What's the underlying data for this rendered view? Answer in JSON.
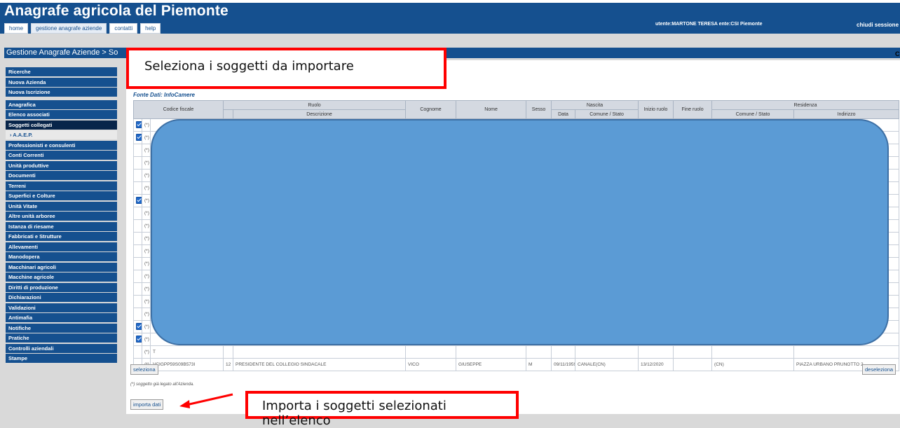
{
  "header": {
    "app_title": "Anagrafe agricola del Piemonte",
    "nav": [
      "home",
      "gestione anagrafe aziende",
      "contatti",
      "help"
    ],
    "user_info": "utente:MARTONE TERESA  ente:CSI Piemonte",
    "logout": "chiudi sessione"
  },
  "breadcrumb": "Gestione Anagrafe Aziende > So",
  "breadcrumb_edge": "C",
  "sidebar": {
    "groups": [
      [
        "Ricerche",
        "Nuova Azienda",
        "Nuova Iscrizione"
      ],
      [
        "Anagrafica",
        "Elenco associati",
        "Soggetti collegati",
        "› A.A.E.P.",
        "Professionisti e consulenti",
        "Conti Correnti",
        "Unità produttive",
        "Documenti",
        "Terreni",
        "Superfici e Colture",
        "Unità Vitate",
        "Altre unità arboree",
        "Istanza di riesame",
        "Fabbricati e Strutture",
        "Allevamenti",
        "Manodopera",
        "Macchinari agricoli",
        "Macchine agricole",
        "Diritti di produzione",
        "Dichiarazioni",
        "Validazioni",
        "Antimafia",
        "Notifiche",
        "Pratiche",
        "Controlli aziendali",
        "Stampe"
      ]
    ]
  },
  "callouts": {
    "select": "Seleziona i soggetti da importare",
    "import": "Importa i soggetti selezionati nell’elenco"
  },
  "section_title": "Fonte Dati: InfoCamere",
  "table": {
    "headers": {
      "codice_fiscale": "Codice fiscale",
      "ruolo": "Ruolo",
      "descrizione": "Descrizione",
      "cognome": "Cognome",
      "nome": "Nome",
      "sesso": "Sesso",
      "nascita": "Nascita",
      "data": "Data",
      "comune_stato": "Comune / Stato",
      "inizio_ruolo": "Inizio ruolo",
      "fine_ruolo": "Fine ruolo",
      "residenza": "Residenza",
      "res_comune_stato": "Comune / Stato",
      "indirizzo": "Indirizzo"
    },
    "first_row_prefix": "(*)",
    "row_marker": "(*)",
    "checked_rows": [
      0,
      1,
      6,
      16,
      17
    ],
    "partial_rows": {
      "row_19_cf": "T",
      "last_row": {
        "marker": "(*)",
        "codice_fiscale": "VCIGPP59S09B573I",
        "ruolo_code": "12",
        "descrizione": "PRESIDENTE DEL COLLEGIO SINDACALE",
        "cognome": "VICO",
        "nome": "GIUSEPPE",
        "sesso": "M",
        "data_nascita": "09/11/1959",
        "comune_nascita": "CANALE(CN)",
        "inizio_ruolo": "13/12/2020",
        "fine_ruolo": "",
        "res_comune": "(CN)",
        "indirizzo": "PIAZZA URBANO PRUNOTTO 2"
      }
    }
  },
  "buttons": {
    "seleziona": "seleziona",
    "deseleziona": "deseleziona",
    "importa": "importa dati"
  },
  "footnote": "(*) soggetto già legato all'Azienda.",
  "colors": {
    "header_bg": "#15508f",
    "redaction": "#5b9bd5",
    "callout_border": "#ff0000"
  }
}
